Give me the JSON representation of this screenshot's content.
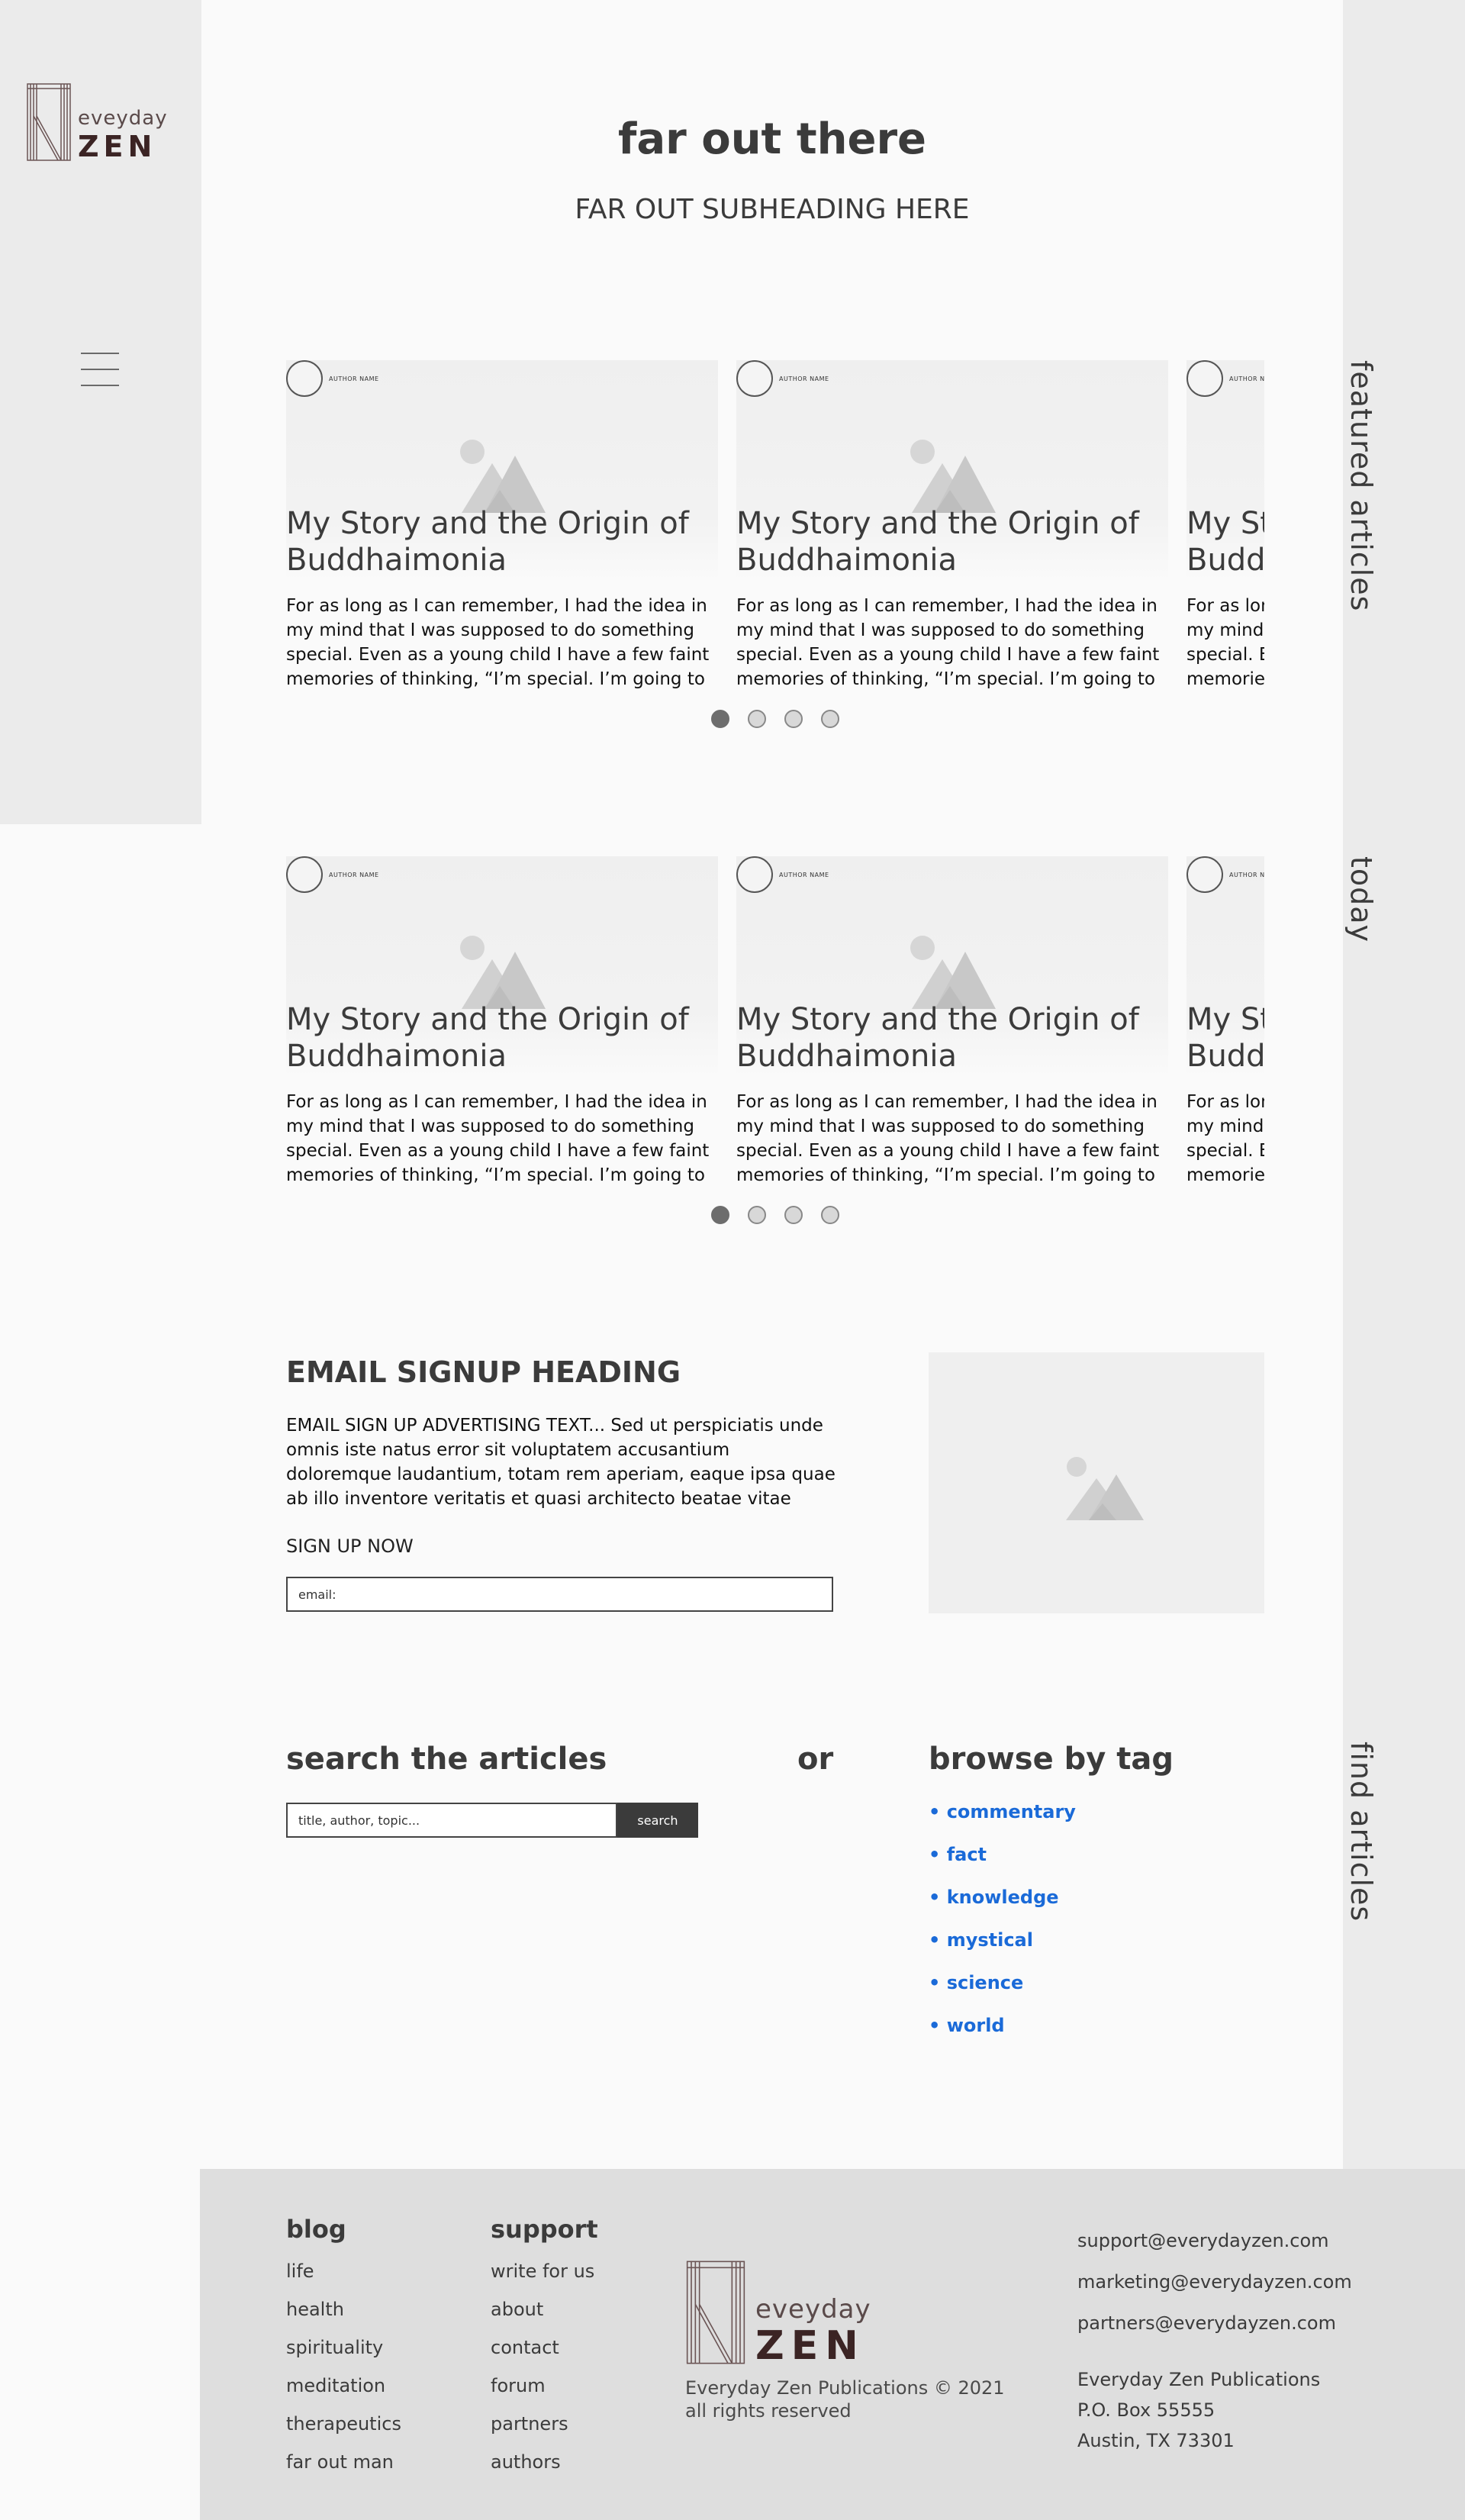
{
  "brand": {
    "logo_word1": "eveyday",
    "logo_word2": "ZEN",
    "colors": {
      "text": "#3b3b3b",
      "panel": "#ebebeb",
      "link": "#1a6ad8",
      "footer": "#dedede"
    }
  },
  "nav": {
    "menu_icon": "hamburger-icon"
  },
  "header": {
    "title": "far out there",
    "subtitle": "FAR OUT SUBHEADING HERE"
  },
  "sections": {
    "featured_label": "featured articles",
    "today_label": "today",
    "find_label": "find articles"
  },
  "carousels": [
    {
      "cards": [
        {
          "author": "AUTHOR NAME",
          "title": "My Story and the Origin of Buddhaimonia",
          "excerpt": "For as long as I can remember, I had the idea in my mind that I was supposed to do something special. Even as a young child I have a few faint memories of thinking, “I’m special. I’m going to"
        },
        {
          "author": "AUTHOR NAME",
          "title": "My Story and the Origin of Buddhaimonia",
          "excerpt": "For as long as I can remember, I had the idea in my mind that I was supposed to do something special. Even as a young child I have a few faint memories of thinking, “I’m special. I’m going to"
        },
        {
          "author": "AUTHOR NAME",
          "title": "My Story and the Origin of Buddhaimonia",
          "excerpt": "For as long as I can remember, I had the idea in my mind that I was supposed to do something special. Even as a young child I have a few faint memories of thinking, “I’m special. I’m going to"
        }
      ],
      "pages": 4,
      "active_page": 1
    },
    {
      "cards": [
        {
          "author": "AUTHOR NAME",
          "title": "My Story and the Origin of Buddhaimonia",
          "excerpt": "For as long as I can remember, I had the idea in my mind that I was supposed to do something special. Even as a young child I have a few faint memories of thinking, “I’m special. I’m going to"
        },
        {
          "author": "AUTHOR NAME",
          "title": "My Story and the Origin of Buddhaimonia",
          "excerpt": "For as long as I can remember, I had the idea in my mind that I was supposed to do something special. Even as a young child I have a few faint memories of thinking, “I’m special. I’m going to"
        },
        {
          "author": "AUTHOR NAME",
          "title": "My Story and the Origin of Buddhaimonia",
          "excerpt": "For as long as I can remember, I had the idea in my mind that I was supposed to do something special. Even as a young child I have a few faint memories of thinking, “I’m special. I’m going to"
        }
      ],
      "pages": 4,
      "active_page": 1
    }
  ],
  "signup": {
    "heading": "EMAIL SIGNUP HEADING",
    "text": "EMAIL SIGN UP ADVERTISING TEXT... Sed ut perspiciatis unde omnis iste natus error sit voluptatem accusantium doloremque laudantium, totam rem aperiam, eaque ipsa quae ab illo inventore veritatis et quasi architecto beatae vitae",
    "cta": "SIGN UP NOW",
    "email_placeholder": "email:",
    "image_icon": "image-placeholder-icon"
  },
  "search": {
    "heading": "search the articles",
    "or": "or",
    "placeholder": "title, author, topic...",
    "button": "search"
  },
  "browse": {
    "heading": "browse by tag",
    "tags": [
      "• commentary",
      "• fact",
      "• knowledge",
      "• mystical",
      "• science",
      "• world"
    ]
  },
  "footer": {
    "blog": {
      "heading": "blog",
      "links": [
        "life",
        "health",
        "spirituality",
        "meditation",
        "therapeutics",
        "far out man"
      ]
    },
    "support": {
      "heading": "support",
      "links": [
        "write for us",
        "about",
        "contact",
        "forum",
        "partners",
        "authors"
      ]
    },
    "copyright_line1": "Everyday Zen Publications © 2021",
    "copyright_line2": "all rights reserved",
    "emails": [
      "support@everydayzen.com",
      "marketing@everydayzen.com",
      "partners@everydayzen.com"
    ],
    "address": [
      "Everyday Zen Publications",
      "P.O. Box 55555",
      "Austin, TX 73301"
    ]
  }
}
